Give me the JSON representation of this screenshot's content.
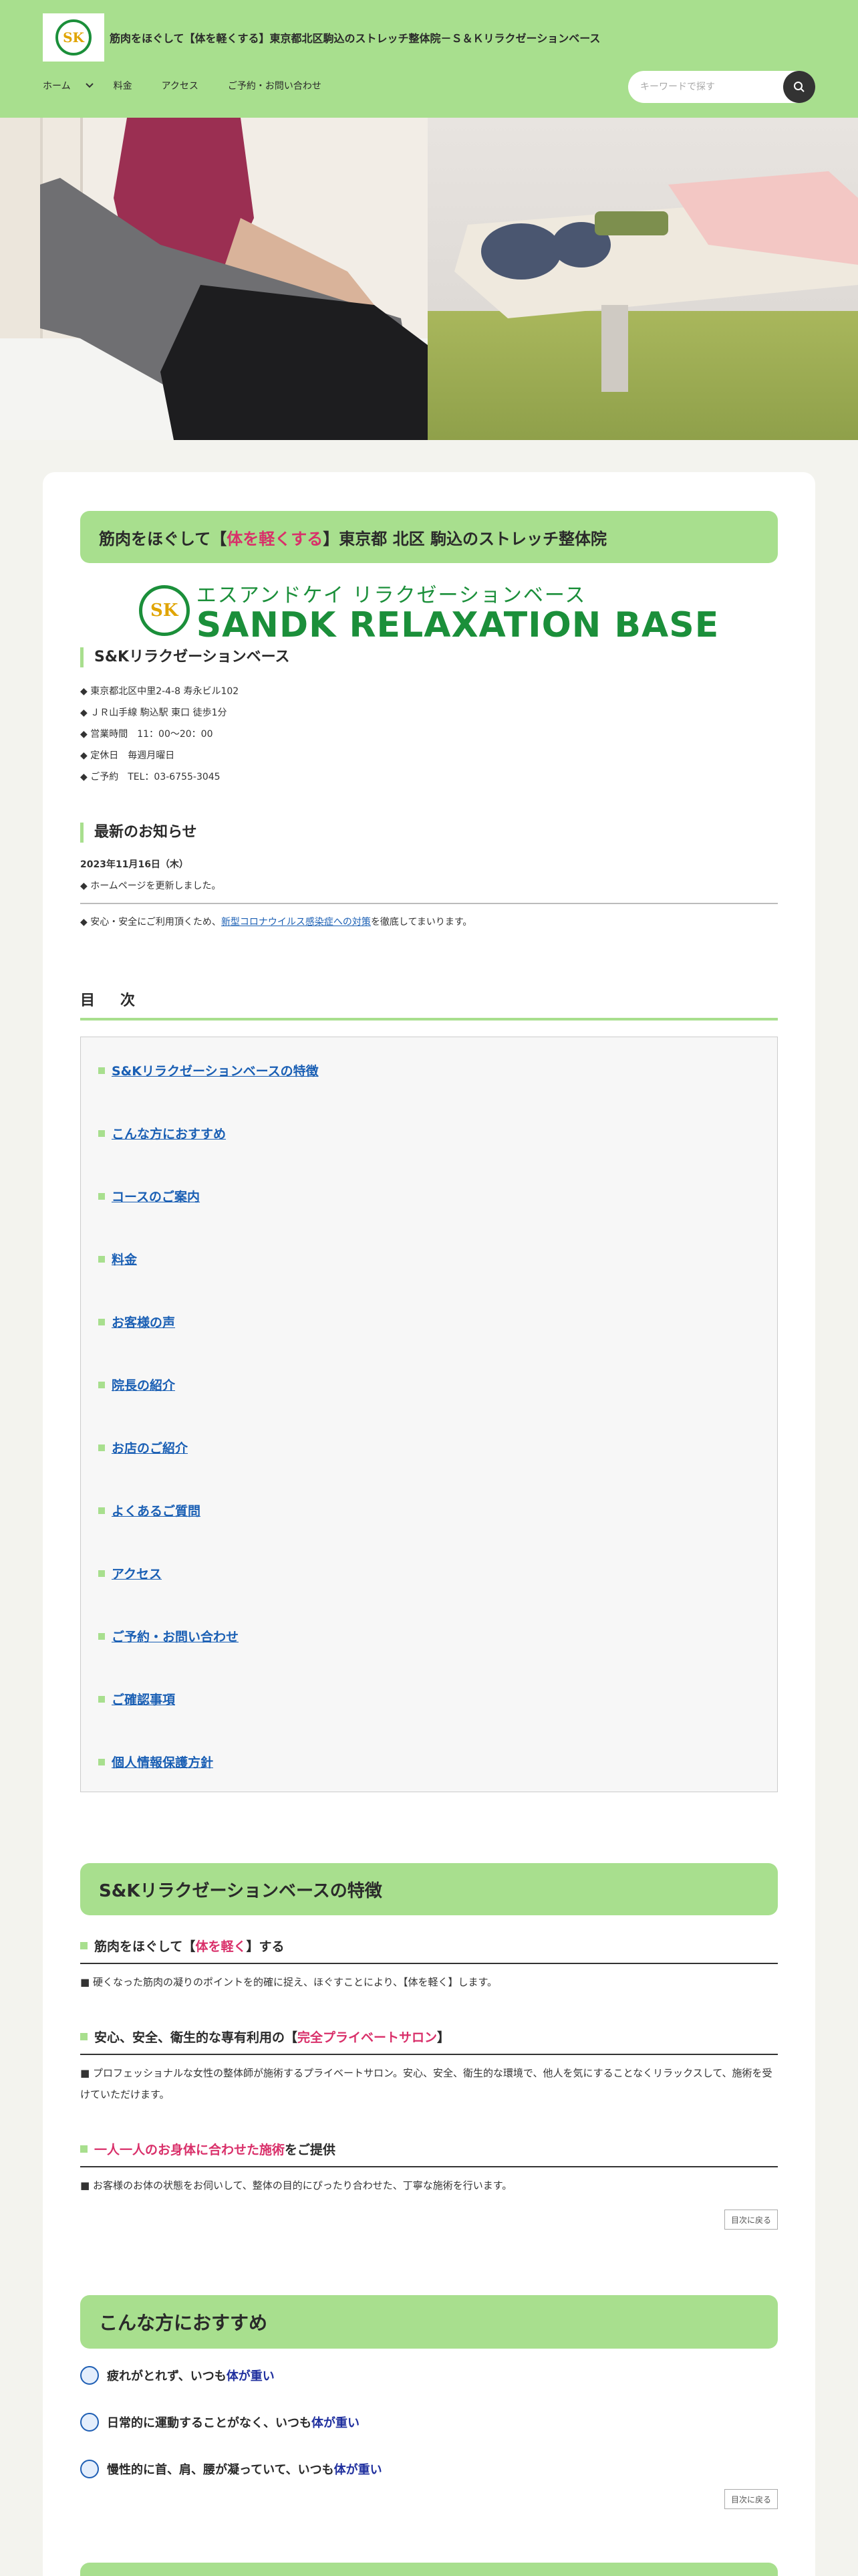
{
  "header": {
    "site_title": "筋肉をほぐして【体を軽くする】東京都北区駒込のストレッチ整体院－Ｓ＆Ｋリラクゼーションベース",
    "logo_letters": "SK",
    "nav": [
      "ホーム",
      "料金",
      "アクセス",
      "ご予約・お問い合わせ"
    ],
    "search_placeholder": "キーワードで探す"
  },
  "main": {
    "banner_pre": "筋肉をほぐして【",
    "banner_emph": "体を軽くする",
    "banner_post": "】東京都 北区 駒込のストレッチ整体院",
    "brand_jp": "エスアンドケイ リラクゼーションベース",
    "brand_en": "SANDK RELAXATION BASE",
    "shop_name": "S&Kリラクゼーションベース",
    "info": [
      "◆ 東京都北区中里2-4-8 寿永ビル102",
      "◆ ＪＲ山手線 駒込駅 東口 徒歩1分",
      "◆ 営業時間　11：00〜20：00",
      "◆ 定休日　毎週月曜日",
      "◆ ご予約　TEL：03-6755-3045"
    ],
    "news_title": "最新のお知らせ",
    "news_date": "2023年11月16日（木）",
    "news_item": "◆ ホームページを更新しました。",
    "covid_pre": "◆ 安心・安全にご利用頂くため、",
    "covid_link": "新型コロナウイルス感染症への対策",
    "covid_post": "を徹底してまいります。"
  },
  "toc": {
    "title": "目　次",
    "items": [
      "S&Kリラクゼーションベースの特徴",
      "こんな方におすすめ",
      "コースのご案内",
      "料金",
      "お客様の声",
      "院長の紹介",
      "お店のご紹介",
      "よくあるご質問",
      "アクセス",
      "ご予約・お問い合わせ",
      "ご確認事項",
      "個人情報保護方針"
    ]
  },
  "features": {
    "title": "S&Kリラクゼーションベースの特徴",
    "f1_pre": "筋肉をほぐして【",
    "f1_emph": "体を軽く",
    "f1_post": "】する",
    "f1_body": "■ 硬くなった筋肉の凝りのポイントを的確に捉え、ほぐすことにより、【体を軽く】します。",
    "f2_pre": "安心、安全、衛生的な専有利用の【",
    "f2_emph": "完全プライベートサロン",
    "f2_post": "】",
    "f2_body": "■ プロフェッショナルな女性の整体師が施術するプライベートサロン。安心、安全、衛生的な環境で、他人を気にすることなくリラックスして、施術を受けていただけます。",
    "f3_emph": "一人一人のお身体に合わせた施術",
    "f3_post": "をご提供",
    "f3_body": "■ お客様のお体の状態をお伺いして、整体の目的にぴったり合わせた、丁寧な施術を行います。",
    "back": "目次に戻る"
  },
  "recommend": {
    "title": "こんな方におすすめ",
    "r1_pre": "疲れがとれず、いつも",
    "r2_pre": "日常的に運動することがなく、いつも",
    "r3_pre": "慢性的に首、肩、腰が凝っていて、いつも",
    "emph": "体が重い",
    "back": "目次に戻る"
  },
  "colors": {
    "header_bg": "#a8df8e",
    "accent_red": "#d9306a",
    "accent_navy": "#1f2f9e",
    "brand_green": "#1b8f3a"
  }
}
